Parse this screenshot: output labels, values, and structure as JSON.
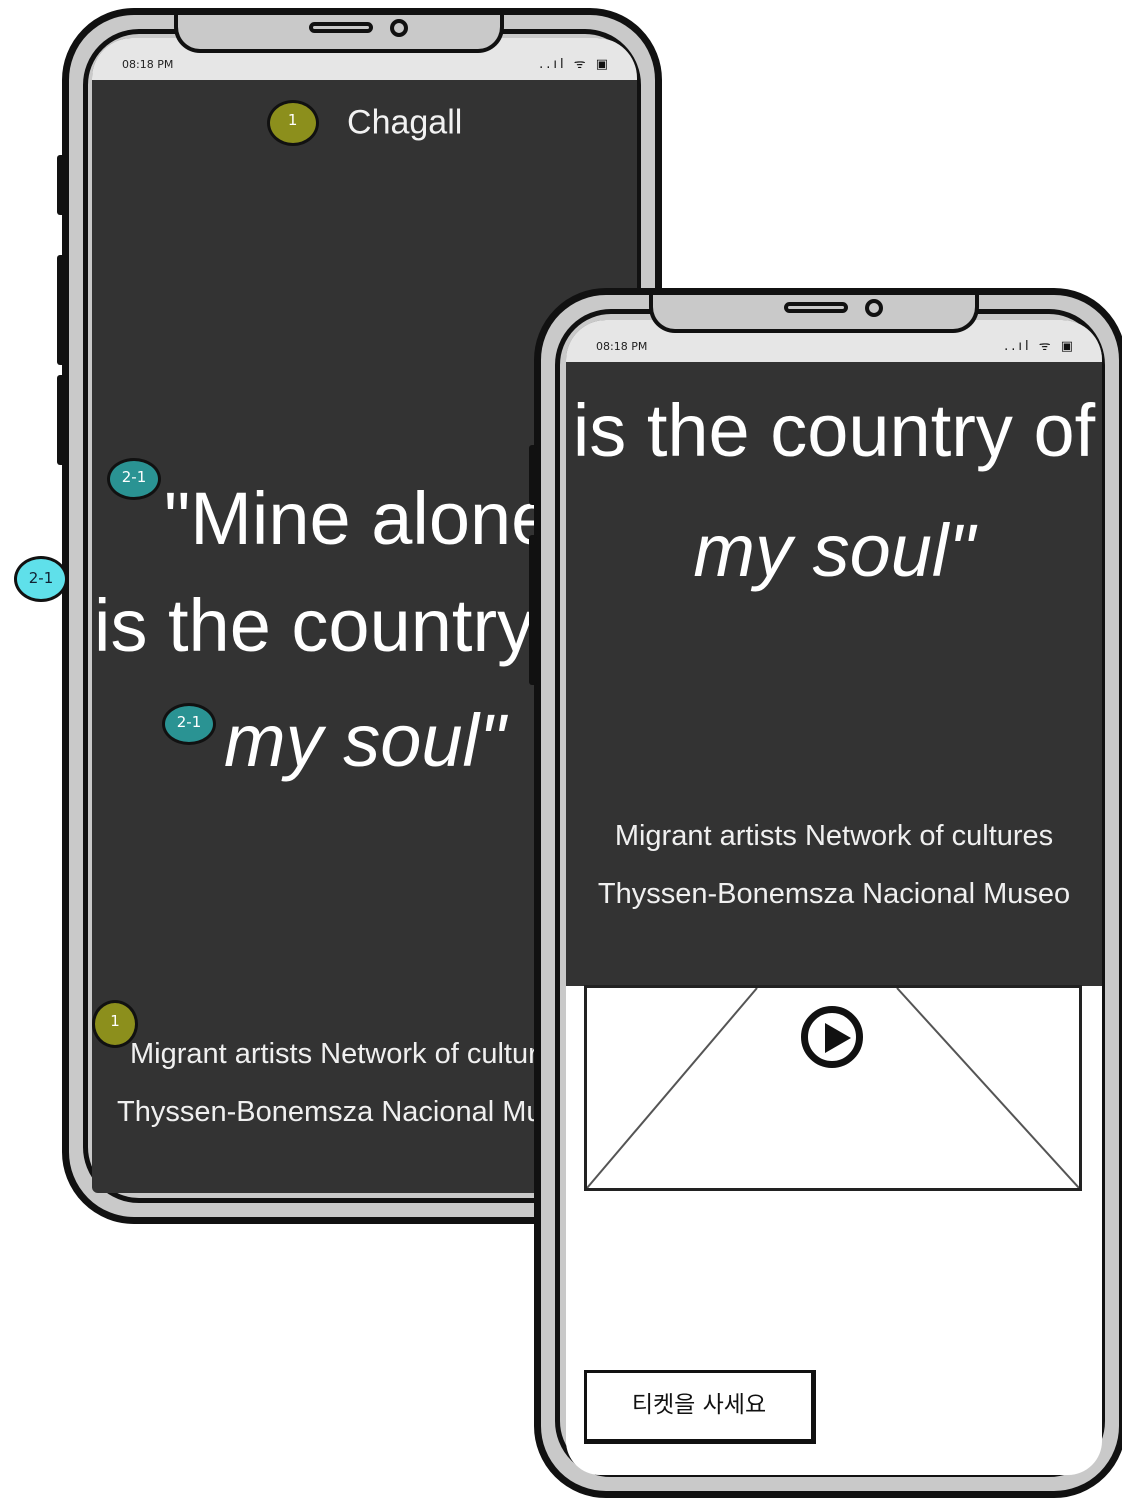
{
  "status_bar": {
    "time": "08:18 PM",
    "icons": "..ıl ᯤ ▣"
  },
  "left_phone": {
    "title": "Chagall",
    "title_marker": "1",
    "quote_marker": "2-1",
    "edge_marker": "2-1",
    "italic_marker": "2-1",
    "footer_marker": "1",
    "quote_line1": "\"Mine alone",
    "quote_line2": "is the country of",
    "quote_line3": "my soul\"",
    "footer_line1": "Migrant artists Network of cultures",
    "footer_line2": "Thyssen-Bonemsza  Nacional Museo"
  },
  "right_phone": {
    "quote_line1": "is the country of",
    "quote_line2": "my soul\"",
    "footer_line1": "Migrant artists Network of cultures",
    "footer_line2": "Thyssen-Bonemsza  Nacional Museo",
    "video_icon": "play-icon",
    "ticket_button": "티켓을 사세요"
  },
  "colors": {
    "screen_dark": "#333333",
    "frame": "#c9c9c9",
    "marker_olive": "#8c8f1c",
    "marker_teal": "#2a9393",
    "marker_cyan": "#5fe0ea"
  }
}
